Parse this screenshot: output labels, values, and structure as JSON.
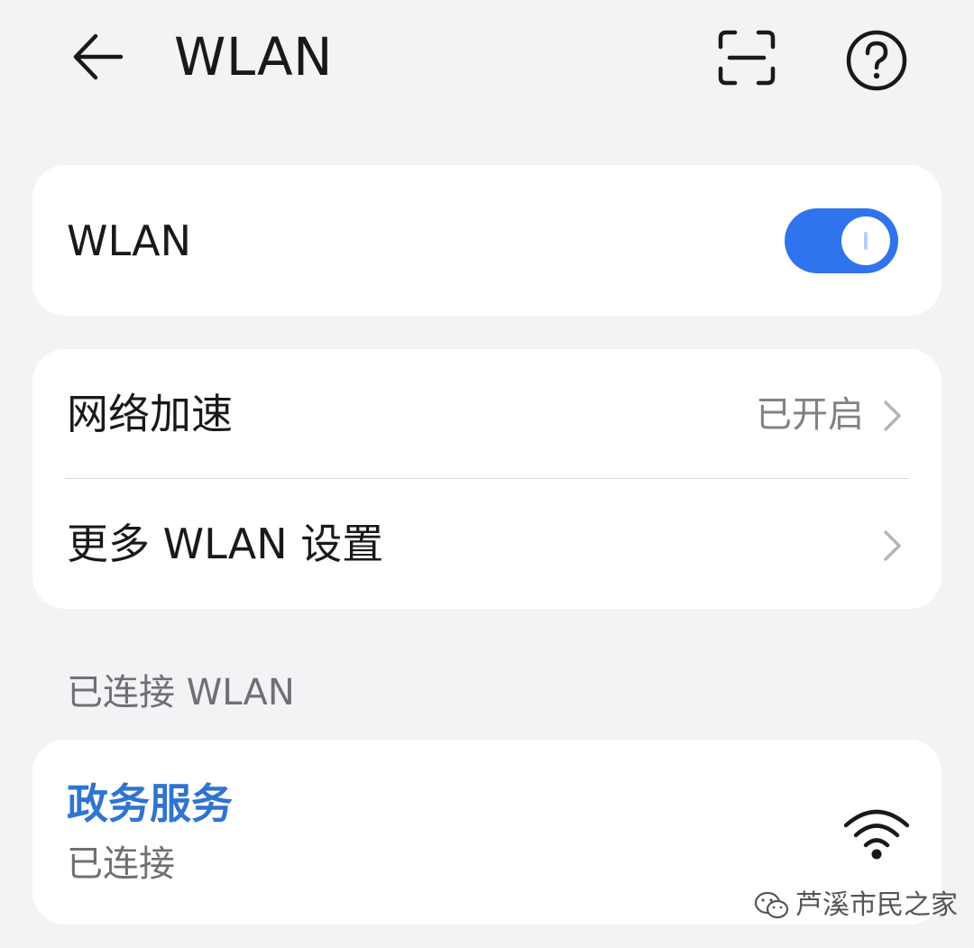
{
  "header": {
    "title": "WLAN",
    "back_icon": "arrow-left-icon",
    "scan_icon": "scan-icon",
    "help_icon": "help-circle-icon"
  },
  "wlan_card": {
    "label": "WLAN",
    "toggle_on": true,
    "toggle_color": "#2f74ec"
  },
  "settings_card": {
    "items": [
      {
        "label": "网络加速",
        "value": "已开启",
        "icon": "chevron-right-icon"
      },
      {
        "label": "更多 WLAN 设置",
        "value": "",
        "icon": "chevron-right-icon"
      }
    ]
  },
  "connected_section": {
    "header": "已连接 WLAN",
    "network": {
      "name": "政务服务",
      "status": "已连接",
      "signal_icon": "wifi-signal-icon",
      "name_color": "#2f74d0"
    }
  },
  "watermark": {
    "text": "芦溪市民之家",
    "icon": "wechat-icon"
  }
}
